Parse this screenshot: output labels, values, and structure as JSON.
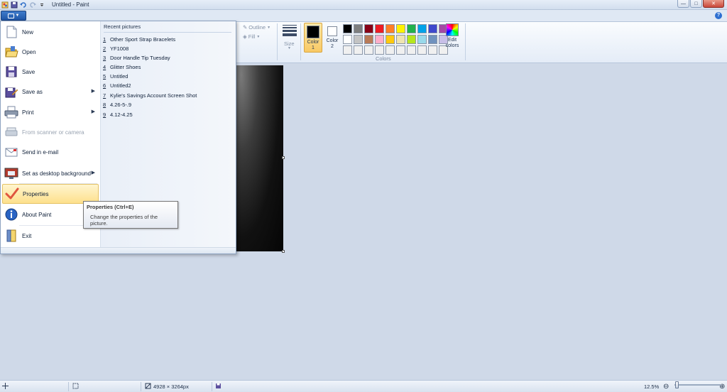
{
  "window": {
    "title": "Untitled - Paint",
    "controls": {
      "minimize": "—",
      "maximize": "□",
      "close": "✕"
    }
  },
  "quick_access": [
    "paint-icon",
    "save-icon",
    "undo-icon",
    "redo-icon",
    "customize-icon"
  ],
  "ribbon": {
    "outline_label": "Outline",
    "fill_label": "Fill",
    "size_label": "Size",
    "color1_label_line1": "Color",
    "color1_label_line2": "1",
    "color2_label_line1": "Color",
    "color2_label_line2": "2",
    "edit_colors_line1": "Edit",
    "edit_colors_line2": "colors",
    "colors_group_title": "Colors",
    "color1_value": "#000000",
    "color2_value": "#ffffff",
    "palette": [
      "#000000",
      "#7f7f7f",
      "#880015",
      "#ed1c24",
      "#ff7f27",
      "#fff200",
      "#22b14c",
      "#00a2e8",
      "#3f48cc",
      "#a349a4",
      "#ffffff",
      "#c3c3c3",
      "#b97a57",
      "#ffaec9",
      "#ffc90e",
      "#efe4b0",
      "#b5e61d",
      "#99d9ea",
      "#7092be",
      "#c8bfe7",
      "#f0f0f0",
      "#f0f0f0",
      "#f0f0f0",
      "#f0f0f0",
      "#f0f0f0",
      "#f0f0f0",
      "#f0f0f0",
      "#f0f0f0",
      "#f0f0f0",
      "#f0f0f0"
    ]
  },
  "file_menu": {
    "items": [
      {
        "label": "New",
        "icon": "new-icon",
        "enabled": true
      },
      {
        "label": "Open",
        "icon": "open-folder-icon",
        "enabled": true
      },
      {
        "label": "Save",
        "icon": "save-icon",
        "enabled": true
      },
      {
        "label": "Save as",
        "icon": "save-as-icon",
        "enabled": true,
        "submenu": true
      },
      {
        "label": "Print",
        "icon": "printer-icon",
        "enabled": true,
        "submenu": true
      },
      {
        "label": "From scanner or camera",
        "icon": "scanner-icon",
        "enabled": false
      },
      {
        "label": "Send in e-mail",
        "icon": "email-icon",
        "enabled": true
      },
      {
        "label": "Set as desktop background",
        "icon": "desktop-icon",
        "enabled": true,
        "submenu": true
      },
      {
        "label": "Properties",
        "icon": "checkmark-icon",
        "enabled": true,
        "highlighted": true
      },
      {
        "label": "About Paint",
        "icon": "info-icon",
        "enabled": true
      },
      {
        "label": "Exit",
        "icon": "exit-icon",
        "enabled": true
      }
    ],
    "recent_header": "Recent pictures",
    "recent": [
      {
        "num": "1",
        "name": "Other Sport Strap Bracelets"
      },
      {
        "num": "2",
        "name": "YF1008"
      },
      {
        "num": "3",
        "name": "Door Handle Tip Tuesday"
      },
      {
        "num": "4",
        "name": "Glitter Shoes"
      },
      {
        "num": "5",
        "name": "Untitled"
      },
      {
        "num": "6",
        "name": "Untitled2"
      },
      {
        "num": "7",
        "name": "Kylie's Savings Account Screen Shot"
      },
      {
        "num": "8",
        "name": "4.26-5-.9"
      },
      {
        "num": "9",
        "name": "4.12-4.25"
      }
    ]
  },
  "tooltip": {
    "title": "Properties (Ctrl+E)",
    "body": "Change the properties of the picture."
  },
  "status": {
    "dimensions": "4928 × 3264px",
    "zoom": "12.5%",
    "zoom_minus": "⊖",
    "zoom_plus": "⊕"
  }
}
